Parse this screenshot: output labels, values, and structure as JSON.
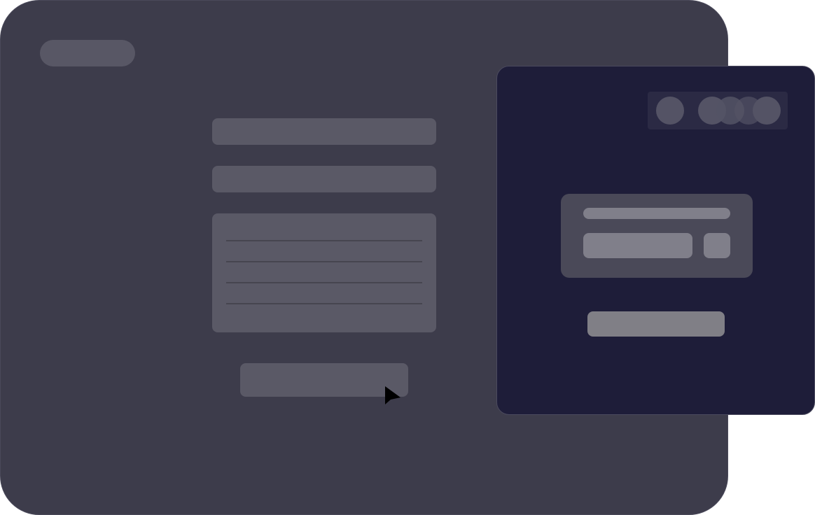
{
  "colors": {
    "main_window_bg": "#3d3c4b",
    "placeholder_block": "#5a5966",
    "overlay_panel_bg": "#1e1d39",
    "overlay_card_bg": "#4a4958",
    "overlay_control": "#807f8a"
  },
  "icons": {
    "cursor": "mouse-pointer-arrow",
    "avatars": [
      "avatar-circle",
      "avatar-circle",
      "avatar-circle",
      "avatar-circle",
      "avatar-circle"
    ]
  },
  "form": {
    "field_count": 2,
    "textarea_line_count": 4
  },
  "overlay": {
    "avatar_count": 5
  }
}
